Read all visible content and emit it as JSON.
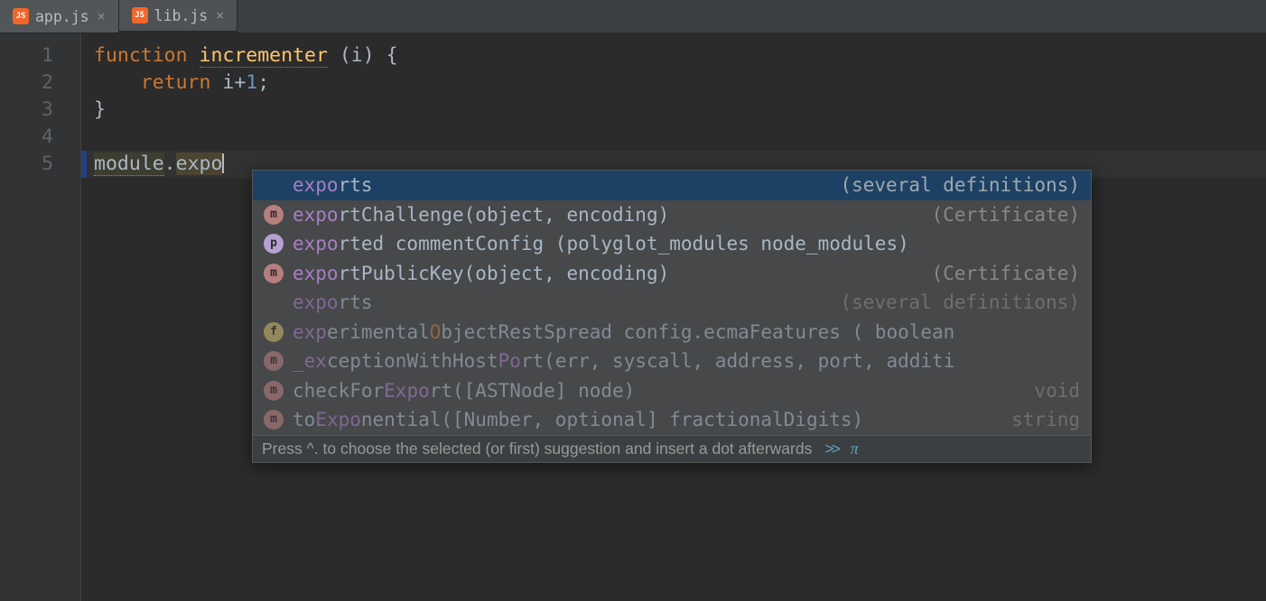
{
  "tabs": [
    {
      "label": "app.js",
      "active": false
    },
    {
      "label": "lib.js",
      "active": true
    }
  ],
  "gutter_lines": [
    "1",
    "2",
    "3",
    "4",
    "5"
  ],
  "code": {
    "line1_kw": "function",
    "line1_fn": "incrementer",
    "line1_paren_open": " (",
    "line1_param": "i",
    "line1_paren_close": ") {",
    "line2_kw": "return",
    "line2_expr_a": " i+",
    "line2_num": "1",
    "line2_semi": ";",
    "line3_brace": "}",
    "line5_obj": "module",
    "line5_dot": ".",
    "line5_typed": "expo"
  },
  "suggestions": [
    {
      "kind": "",
      "matched": "expo",
      "rest": "rts",
      "tail": "(several definitions)",
      "selected": true
    },
    {
      "kind": "m",
      "matched": "expo",
      "rest": "rtChallenge(object, encoding) ",
      "tail": "(Certificate)"
    },
    {
      "kind": "p",
      "matched": "expo",
      "rest": "rted commentConfig (polyglot_modules node_modules)",
      "tail": ""
    },
    {
      "kind": "m",
      "matched": "expo",
      "rest": "rtPublicKey(object, encoding) ",
      "tail": "(Certificate)"
    },
    {
      "kind": "",
      "matched": "expo",
      "rest": "rts",
      "tail": "(several definitions)",
      "dim": true
    },
    {
      "kind": "f",
      "matched": "exp",
      "rest": "erimentalObjectRestSpread config.ecmaFeatures ( boolean",
      "tail": "",
      "dim": true,
      "orange_o": true
    },
    {
      "kind": "m",
      "matched": "_ex",
      "rest": "ceptionWithHostPort(err, syscall, address, port, additi",
      "tail": "",
      "dim": true,
      "inner_hl": "Po"
    },
    {
      "kind": "m",
      "matched": "",
      "rest": "checkForExport([ASTNode] node)",
      "tail": "void",
      "dim": true,
      "inner_hl": "Expo"
    },
    {
      "kind": "m",
      "matched": "",
      "rest": "toExponential([Number, optional] fractionalDigits)",
      "tail": " string",
      "dim": true,
      "inner_hl": "Expo"
    }
  ],
  "footer": {
    "text": "Press ^. to choose the selected (or first) suggestion and insert a dot afterwards",
    "chev": ">>",
    "pi": "π"
  }
}
